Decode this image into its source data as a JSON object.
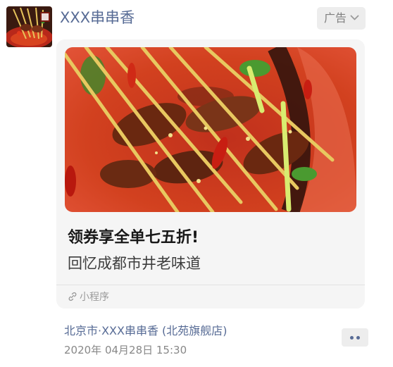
{
  "post": {
    "advertiser_name": "XXX串串香",
    "ad_tag_label": "广告",
    "card": {
      "headline": "领券享全单七五折!",
      "subline": "回忆成都市井老味道",
      "mini_program_label": "小程序"
    },
    "location": "北京市·XXX串串香 (北苑旗舰店)",
    "timestamp": "2020年 04月28日 15:30"
  },
  "colors": {
    "link_blue": "#576b95",
    "card_bg": "#f5f5f5",
    "tag_bg": "#ededed"
  },
  "icons": {
    "ad_tag": "chevron-down-icon",
    "mini_program": "link-icon",
    "more": "more-dots-icon"
  }
}
